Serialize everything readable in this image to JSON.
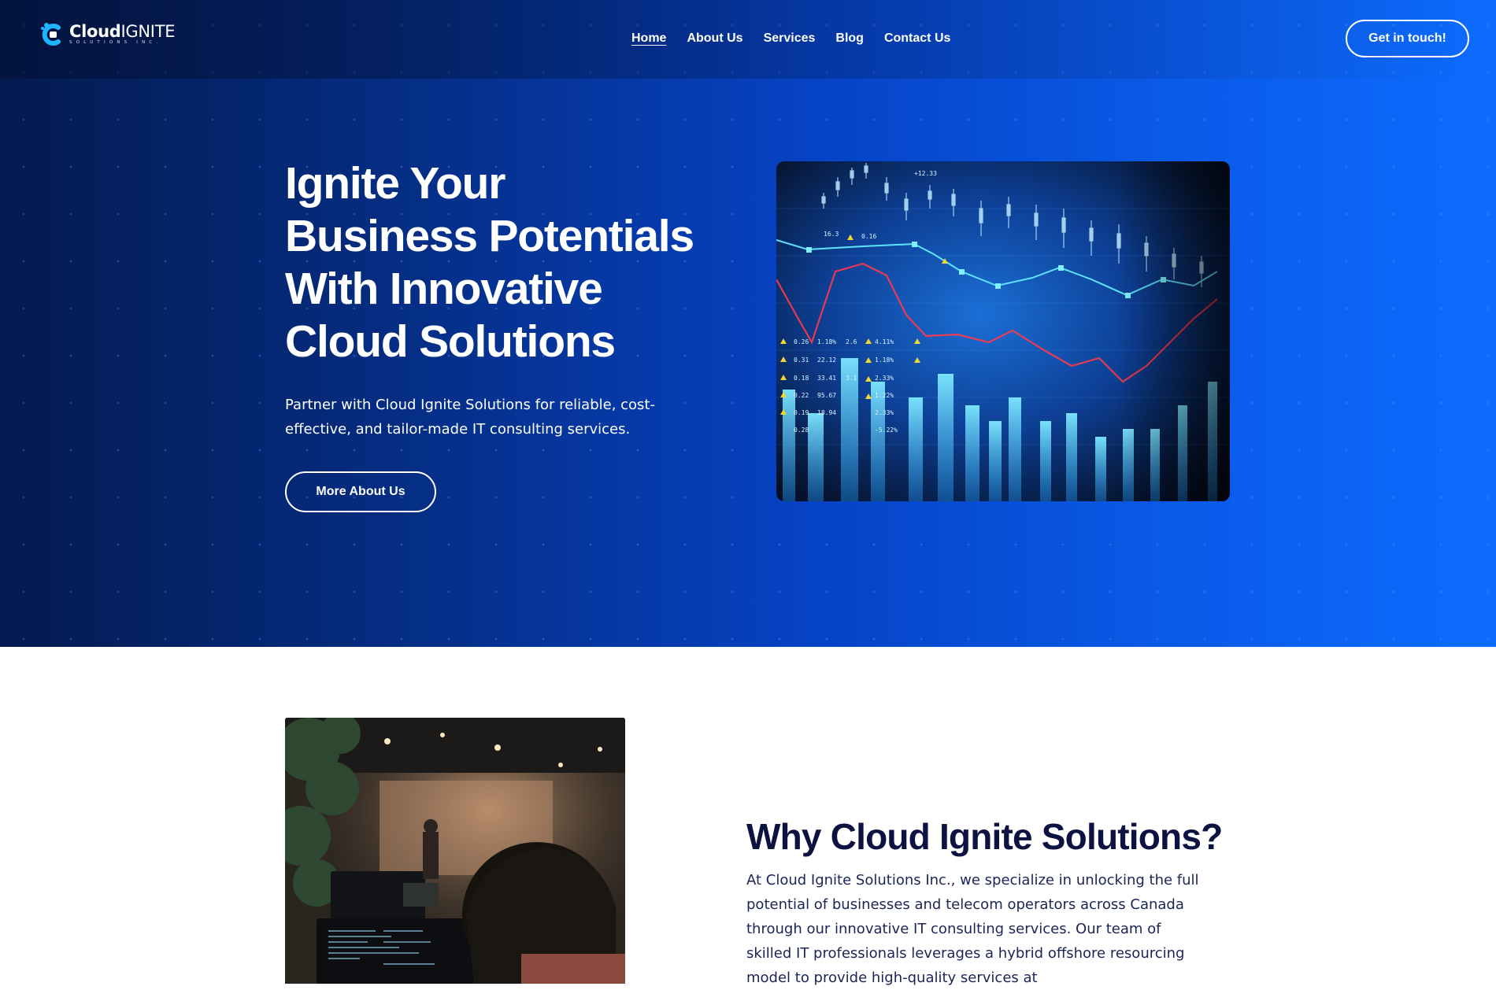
{
  "brand": {
    "name_bold": "Cloud",
    "name_light": "IGNITE",
    "tagline": "SOLUTIONS INC."
  },
  "nav": {
    "items": [
      {
        "label": "Home",
        "active": true
      },
      {
        "label": "About Us",
        "active": false
      },
      {
        "label": "Services",
        "active": false
      },
      {
        "label": "Blog",
        "active": false
      },
      {
        "label": "Contact Us",
        "active": false
      }
    ],
    "cta_label": "Get in touch!"
  },
  "hero": {
    "title_lines": [
      "Ignite Your",
      "Business Potentials",
      "With Innovative",
      "Cloud Solutions"
    ],
    "subtitle": "Partner with Cloud Ignite Solutions for reliable, cost-effective, and tailor-made IT consulting services.",
    "button_label": "More About Us",
    "image_alt": "stock market data chart"
  },
  "about": {
    "title": "Why Cloud Ignite Solutions?",
    "body": "At Cloud Ignite Solutions Inc., we specialize in unlocking the full potential of businesses and telecom operators across Canada through our innovative IT consulting services. Our team of skilled IT professionals leverages a hybrid offshore resourcing model to provide high-quality services at",
    "image_alt": "developer working on computer"
  },
  "colors": {
    "hero_dark": "#041a4f",
    "hero_bright": "#0d6cff",
    "heading_navy": "#0c1340",
    "logo_cyan": "#1fb6ff"
  }
}
